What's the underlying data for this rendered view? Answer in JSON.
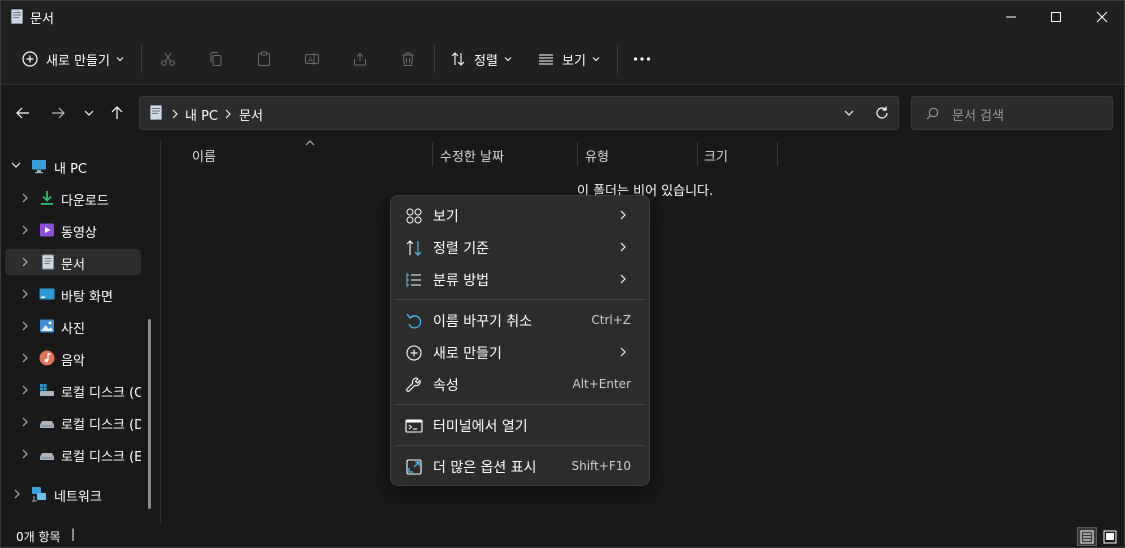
{
  "window": {
    "title": "문서"
  },
  "toolbar": {
    "new_label": "새로 만들기",
    "sort_label": "정렬",
    "view_label": "보기"
  },
  "address": {
    "crumbs": [
      "내 PC",
      "문서"
    ],
    "search_placeholder": "문서 검색"
  },
  "sidebar": {
    "items": [
      {
        "label": "내 PC"
      },
      {
        "label": "다운로드"
      },
      {
        "label": "동영상"
      },
      {
        "label": "문서"
      },
      {
        "label": "바탕 화면"
      },
      {
        "label": "사진"
      },
      {
        "label": "음악"
      },
      {
        "label": "로컬 디스크 (C:"
      },
      {
        "label": "로컬 디스크 (D:"
      },
      {
        "label": "로컬 디스크 (E:"
      },
      {
        "label": "네트워크"
      }
    ]
  },
  "columns": [
    "이름",
    "수정한 날짜",
    "유형",
    "크기"
  ],
  "empty_message": "이 폴더는 비어 있습니다.",
  "context_menu": {
    "items": [
      {
        "label": "보기",
        "shortcut": ""
      },
      {
        "label": "정렬 기준",
        "shortcut": ""
      },
      {
        "label": "분류 방법",
        "shortcut": ""
      },
      {
        "label": "이름 바꾸기 취소",
        "shortcut": "Ctrl+Z"
      },
      {
        "label": "새로 만들기",
        "shortcut": ""
      },
      {
        "label": "속성",
        "shortcut": "Alt+Enter"
      },
      {
        "label": "터미널에서 열기",
        "shortcut": ""
      },
      {
        "label": "더 많은 옵션 표시",
        "shortcut": "Shift+F10"
      }
    ]
  },
  "status": {
    "item_count": "0개 항목"
  },
  "colors": {
    "accent": "#4cc2ff",
    "background": "#191919",
    "menu": "#2c2c2c"
  }
}
